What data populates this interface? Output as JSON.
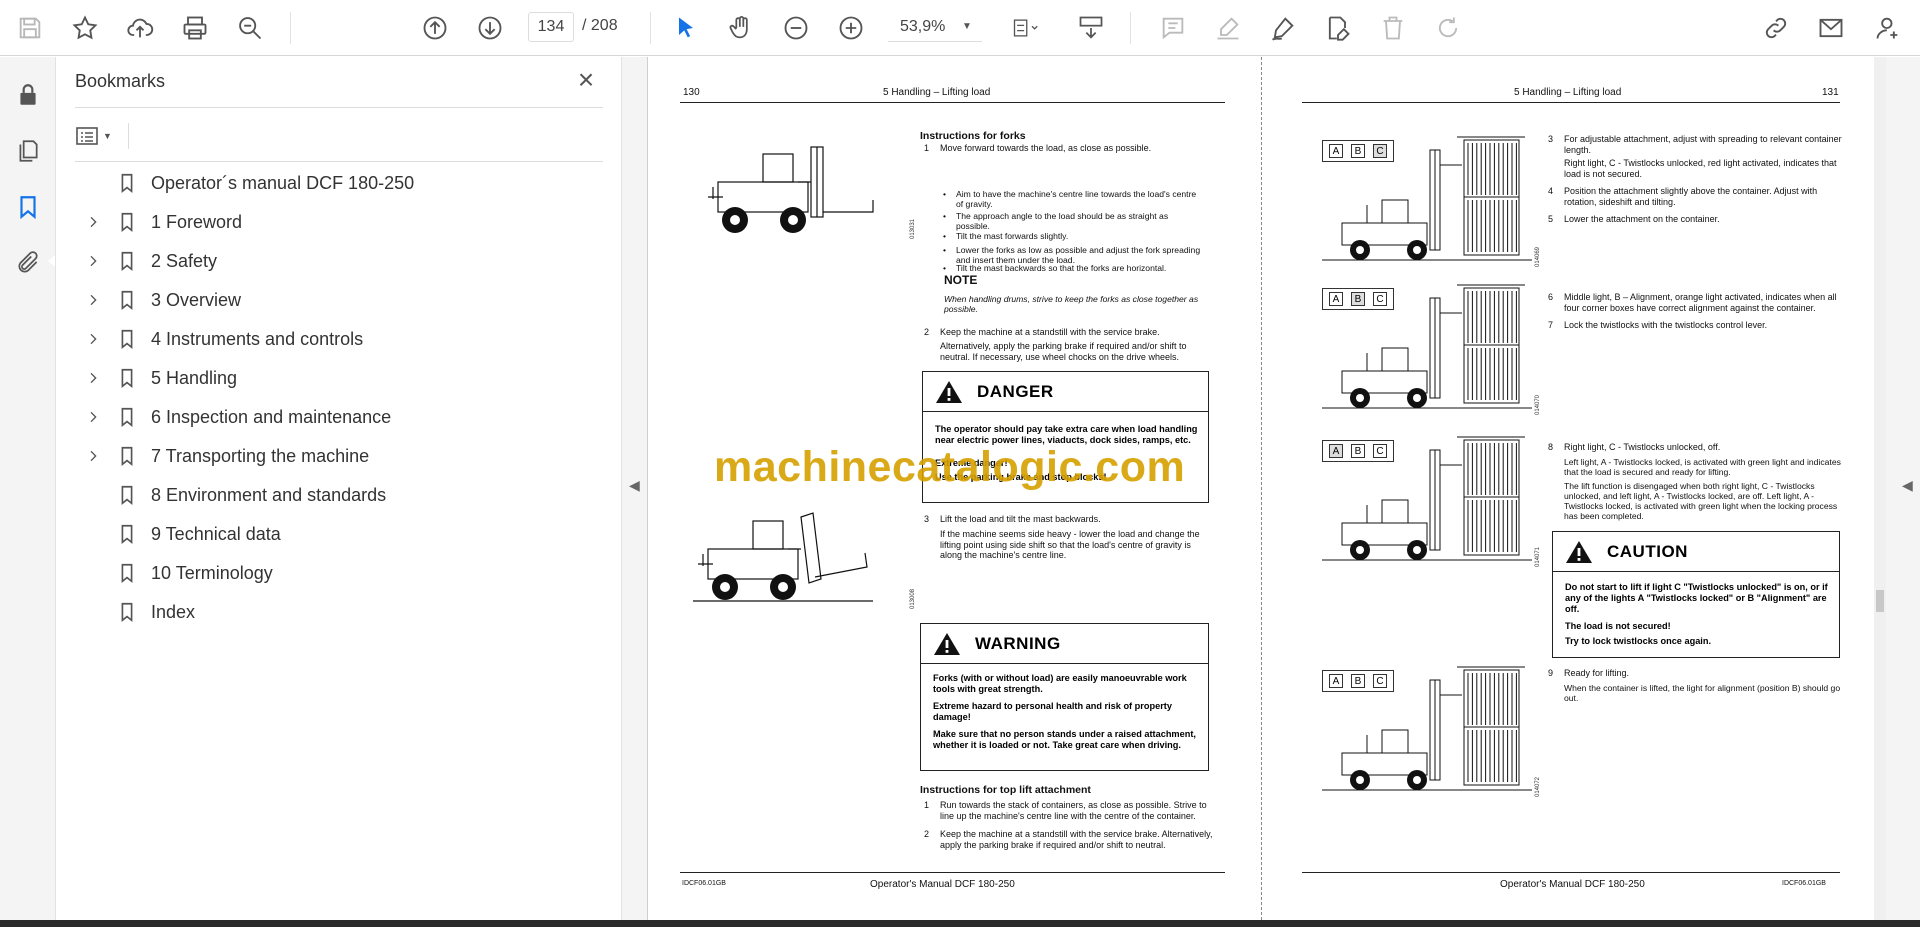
{
  "toolbar": {
    "page_current": "134",
    "page_total": "/ 208",
    "zoom": "53,9%"
  },
  "bookmarks_panel": {
    "title": "Bookmarks",
    "items": [
      {
        "label": "Operator´s manual DCF 180-250",
        "expandable": false
      },
      {
        "label": "1 Foreword",
        "expandable": true
      },
      {
        "label": "2 Safety",
        "expandable": true
      },
      {
        "label": "3 Overview",
        "expandable": true
      },
      {
        "label": "4 Instruments and controls",
        "expandable": true
      },
      {
        "label": "5 Handling",
        "expandable": true
      },
      {
        "label": "6 Inspection and maintenance",
        "expandable": true
      },
      {
        "label": "7 Transporting the machine",
        "expandable": true
      },
      {
        "label": "8 Environment and standards",
        "expandable": false
      },
      {
        "label": "9 Technical data",
        "expandable": false
      },
      {
        "label": "10 Terminology",
        "expandable": false
      },
      {
        "label": "Index",
        "expandable": false
      }
    ]
  },
  "watermark": "machinecatalogic.com",
  "page_left": {
    "number": "130",
    "header": "5 Handling – Lifting load",
    "footer_code": "IDCF06.01GB",
    "footer_title": "Operator's Manual DCF 180-250",
    "fig1_code": "013031",
    "fig2_code": "013008",
    "forks_title": "Instructions for forks",
    "step1_num": "1",
    "step1": "Move forward towards the load, as close as possible.",
    "bullets": [
      "Aim to have the machine's centre line towards the load's centre of gravity.",
      "The approach angle to the load should be as straight as possible.",
      "Tilt the mast forwards slightly.",
      "Lower the forks as low as possible and adjust the fork spreading and insert them under the load.",
      "Tilt the mast backwards so that the forks are horizontal."
    ],
    "note_title": "NOTE",
    "note_text": "When handling drums, strive to keep the forks as close together as possible.",
    "step2_num": "2",
    "step2": "Keep the machine at a standstill with the service brake.",
    "step2_sub": "Alternatively, apply the parking brake if required and/or shift to neutral. If necessary, use wheel chocks on the drive wheels.",
    "danger_title": "DANGER",
    "danger_lines": [
      "The operator should pay take extra care when load handling near electric power lines, viaducts, dock sides, ramps, etc.",
      "Extreme danger!",
      "Use the parking brake and stop blocks!"
    ],
    "step3_num": "3",
    "step3": "Lift the load and tilt the mast backwards.",
    "step3_sub": "If the machine seems side heavy - lower the load and change the lifting point using side shift so that the load's centre of gravity is along the machine's centre line.",
    "warning_title": "WARNING",
    "warning_lines": [
      "Forks (with or without load) are easily manoeuvrable work tools with great strength.",
      "Extreme hazard to personal health and risk of property damage!",
      "Make sure that no person stands under a raised attachment, whether it is loaded or not. Take great care when driving."
    ],
    "toplift_title": "Instructions for top lift attachment",
    "tl1_num": "1",
    "tl1": "Run towards the stack of containers, as close as possible. Strive to line up the machine's centre line with the centre of the container.",
    "tl2_num": "2",
    "tl2": "Keep the machine at a standstill with the service brake. Alternatively, apply the parking brake if required and/or shift to neutral."
  },
  "page_right": {
    "number": "131",
    "header": "5 Handling – Lifting load",
    "footer_code": "IDCF06.01GB",
    "footer_title": "Operator's Manual DCF 180-250",
    "abc": [
      "A",
      "B",
      "C"
    ],
    "fig_codes": [
      "014069",
      "014070",
      "014071",
      "014072"
    ],
    "s3_num": "3",
    "s3": "For adjustable attachment, adjust with spreading to relevant container length.",
    "s3_sub": "Right light, C - Twistlocks unlocked, red light activated, indicates that load is not secured.",
    "s4_num": "4",
    "s4": "Position the attachment slightly above the container. Adjust with rotation, sideshift and tilting.",
    "s5_num": "5",
    "s5": "Lower the attachment on the container.",
    "s6_num": "6",
    "s6": "Middle light, B – Alignment, orange light activated, indicates when all four corner boxes have correct alignment against the container.",
    "s7_num": "7",
    "s7": "Lock the twistlocks with the twistlocks control lever.",
    "s8_num": "8",
    "s8": "Right light, C - Twistlocks unlocked, off.",
    "s8_sub1": "Left light, A - Twistlocks locked, is activated with green light and indicates that the load is secured and ready for lifting.",
    "s8_sub2": "The lift function is disengaged when both right light, C - Twistlocks unlocked, and left light, A - Twistlocks locked, are off. Left light, A - Twistlocks locked, is activated with green light when the locking process has been completed.",
    "caution_title": "CAUTION",
    "caution_lines": [
      "Do not start to lift if light C \"Twistlocks unlocked\" is on, or if any of the lights A \"Twistlocks locked\" or B \"Alignment\" are off.",
      "The load is not secured!",
      "Try to lock twistlocks once again."
    ],
    "s9_num": "9",
    "s9": "Ready for lifting.",
    "s9_sub": "When the container is lifted, the light for alignment (position B) should go out."
  }
}
